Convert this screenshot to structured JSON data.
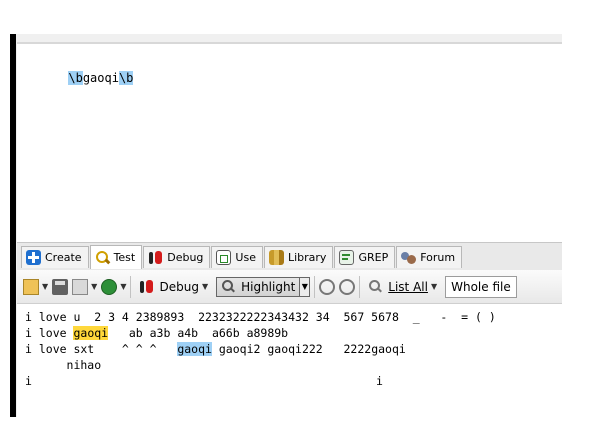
{
  "regex": {
    "escape_start": "\\b",
    "word": "gaoqi",
    "escape_end": "\\b"
  },
  "tabs": [
    {
      "label": "Create",
      "icon": "create-icon"
    },
    {
      "label": "Test",
      "icon": "magnifier-icon"
    },
    {
      "label": "Debug",
      "icon": "bug-icon"
    },
    {
      "label": "Use",
      "icon": "use-icon"
    },
    {
      "label": "Library",
      "icon": "library-icon"
    },
    {
      "label": "GREP",
      "icon": "grep-icon"
    },
    {
      "label": "Forum",
      "icon": "forum-icon"
    }
  ],
  "toolbar": {
    "debug_label": "Debug",
    "highlight_label": "Highlight",
    "list_all_label": "List All",
    "scope_value": "Whole file"
  },
  "results": {
    "line1": "i love u  2 3 4 2389893  2232322222343432 34  567 5678  _   -  = ( )",
    "line2_prefix": "i love ",
    "line2_match": "gaoqi",
    "line2_suffix": "   ab a3b a4b  a66b a8989b",
    "line3_prefix": "i love sxt    ^ ^ ^   ",
    "line3_match": "gaoqi",
    "line3_suffix": " gaoqi2 gaoqi222   2222gaoqi",
    "line4": "      nihao",
    "line5_left": "i",
    "line5_right": "i"
  },
  "colors": {
    "match_blue": "#9ed0f5",
    "match_yellow": "#ffd83b"
  }
}
